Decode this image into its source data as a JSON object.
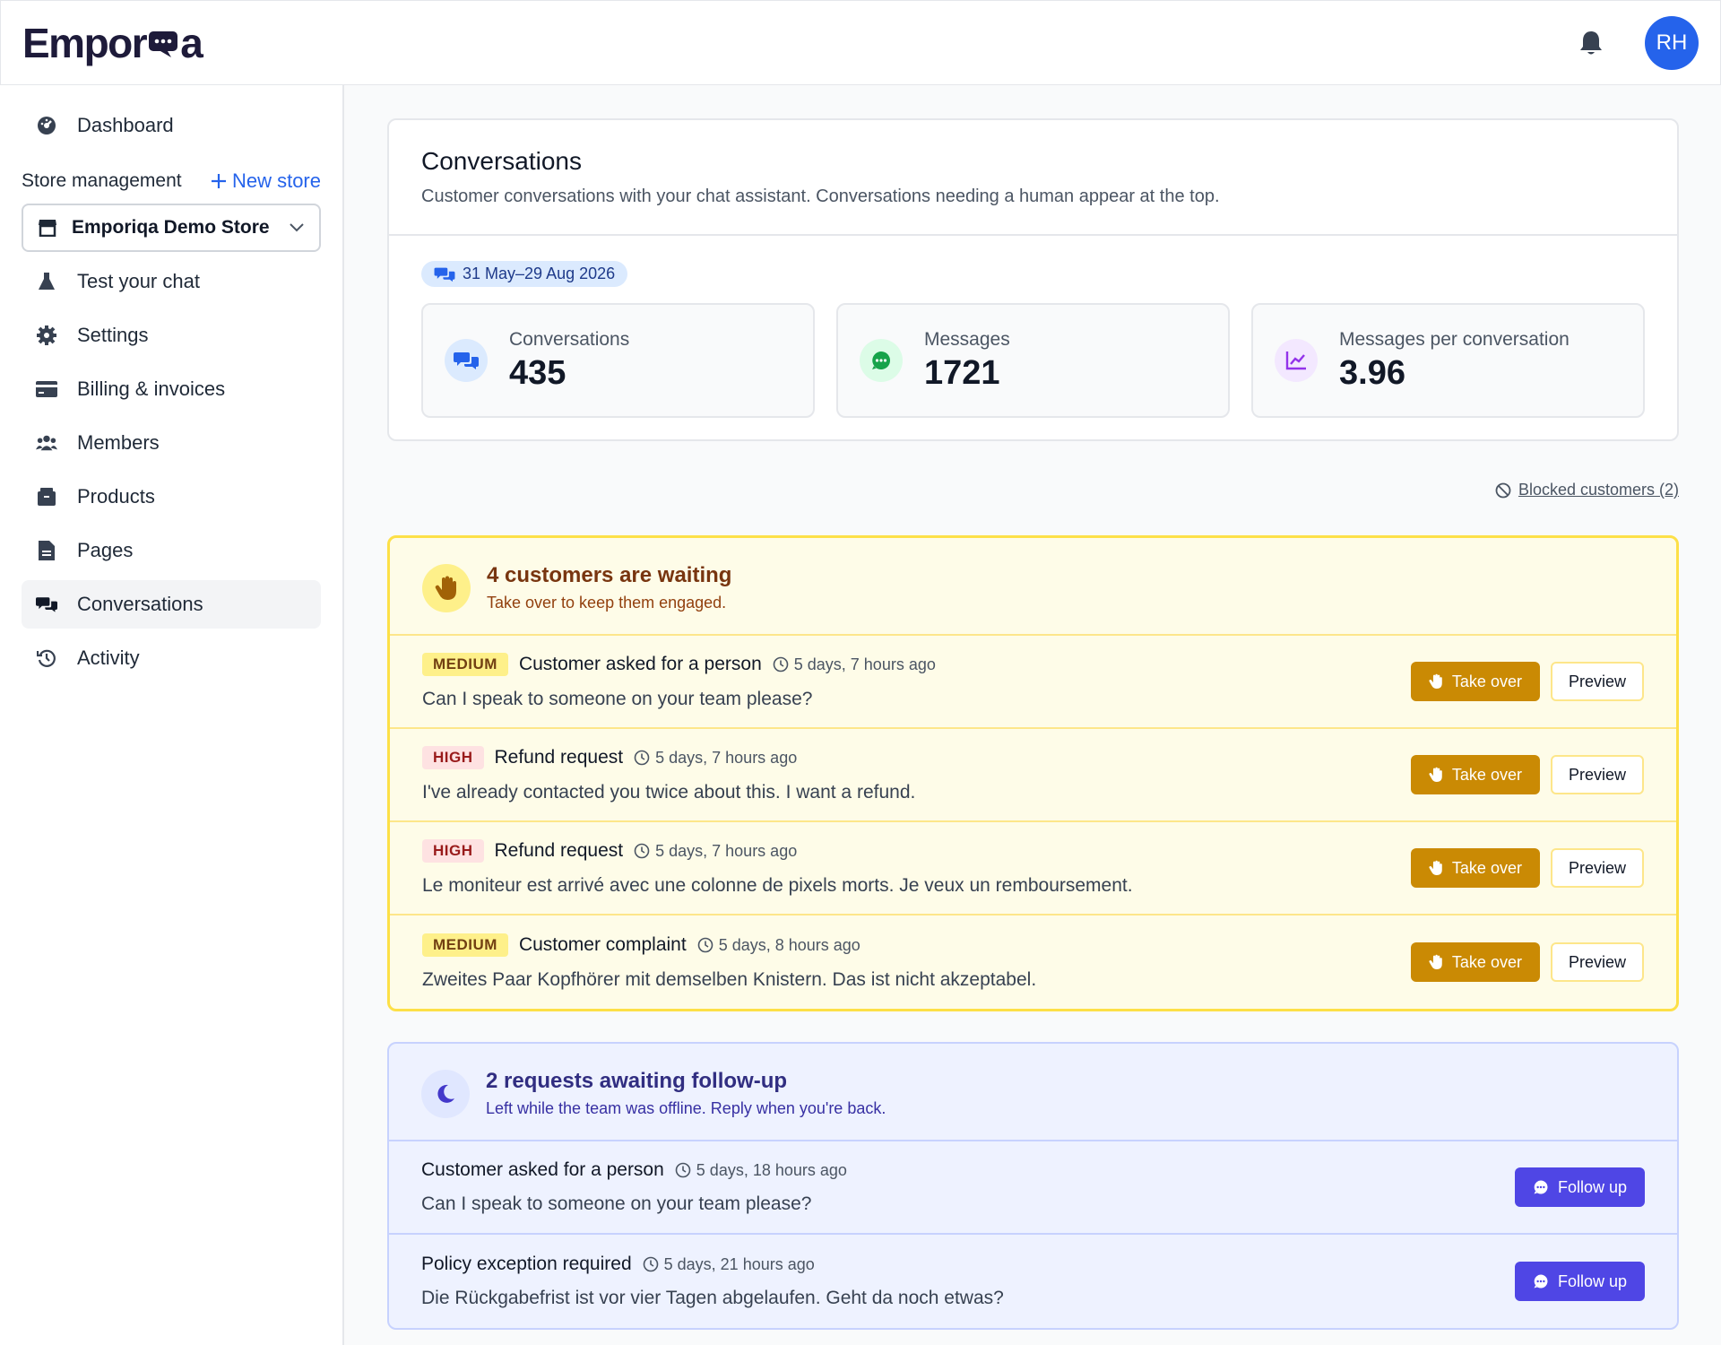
{
  "app": {
    "logo_left": "Empor",
    "logo_right": "a",
    "avatar_initials": "RH"
  },
  "sidebar": {
    "dashboard": "Dashboard",
    "store_management": "Store management",
    "new_store": "New store",
    "store_selected": "Emporiqa Demo Store",
    "items": [
      {
        "label": "Test your chat"
      },
      {
        "label": "Settings"
      },
      {
        "label": "Billing & invoices"
      },
      {
        "label": "Members"
      },
      {
        "label": "Products"
      },
      {
        "label": "Pages"
      },
      {
        "label": "Conversations"
      },
      {
        "label": "Activity"
      }
    ]
  },
  "header": {
    "title": "Conversations",
    "subtitle": "Customer conversations with your chat assistant. Conversations needing a human appear at the top.",
    "date_range": "31 May–29 Aug 2026"
  },
  "stats": [
    {
      "label": "Conversations",
      "value": "435"
    },
    {
      "label": "Messages",
      "value": "1721"
    },
    {
      "label": "Messages per conversation",
      "value": "3.96"
    }
  ],
  "blocked_link": "Blocked customers (2)",
  "waiting": {
    "title": "4 customers are waiting",
    "subtitle": "Take over to keep them engaged.",
    "take_over_label": "Take over",
    "preview_label": "Preview",
    "rows": [
      {
        "priority": "MEDIUM",
        "title": "Customer asked for a person",
        "time": "5 days, 7 hours ago",
        "message": "Can I speak to someone on your team please?"
      },
      {
        "priority": "HIGH",
        "title": "Refund request",
        "time": "5 days, 7 hours ago",
        "message": "I've already contacted you twice about this. I want a refund."
      },
      {
        "priority": "HIGH",
        "title": "Refund request",
        "time": "5 days, 7 hours ago",
        "message": "Le moniteur est arrivé avec une colonne de pixels morts. Je veux un remboursement."
      },
      {
        "priority": "MEDIUM",
        "title": "Customer complaint",
        "time": "5 days, 8 hours ago",
        "message": "Zweites Paar Kopfhörer mit demselben Knistern. Das ist nicht akzeptabel."
      }
    ]
  },
  "followup": {
    "title": "2 requests awaiting follow-up",
    "subtitle": "Left while the team was offline. Reply when you're back.",
    "follow_up_label": "Follow up",
    "rows": [
      {
        "title": "Customer asked for a person",
        "time": "5 days, 18 hours ago",
        "message": "Can I speak to someone on your team please?"
      },
      {
        "title": "Policy exception required",
        "time": "5 days, 21 hours ago",
        "message": "Die Rückgabefrist ist vor vier Tagen abgelaufen. Geht da noch etwas?"
      }
    ]
  },
  "colors": {
    "primary_blue": "#2563eb",
    "waiting_accent": "#ca8a04",
    "followup_accent": "#4f46e5"
  }
}
